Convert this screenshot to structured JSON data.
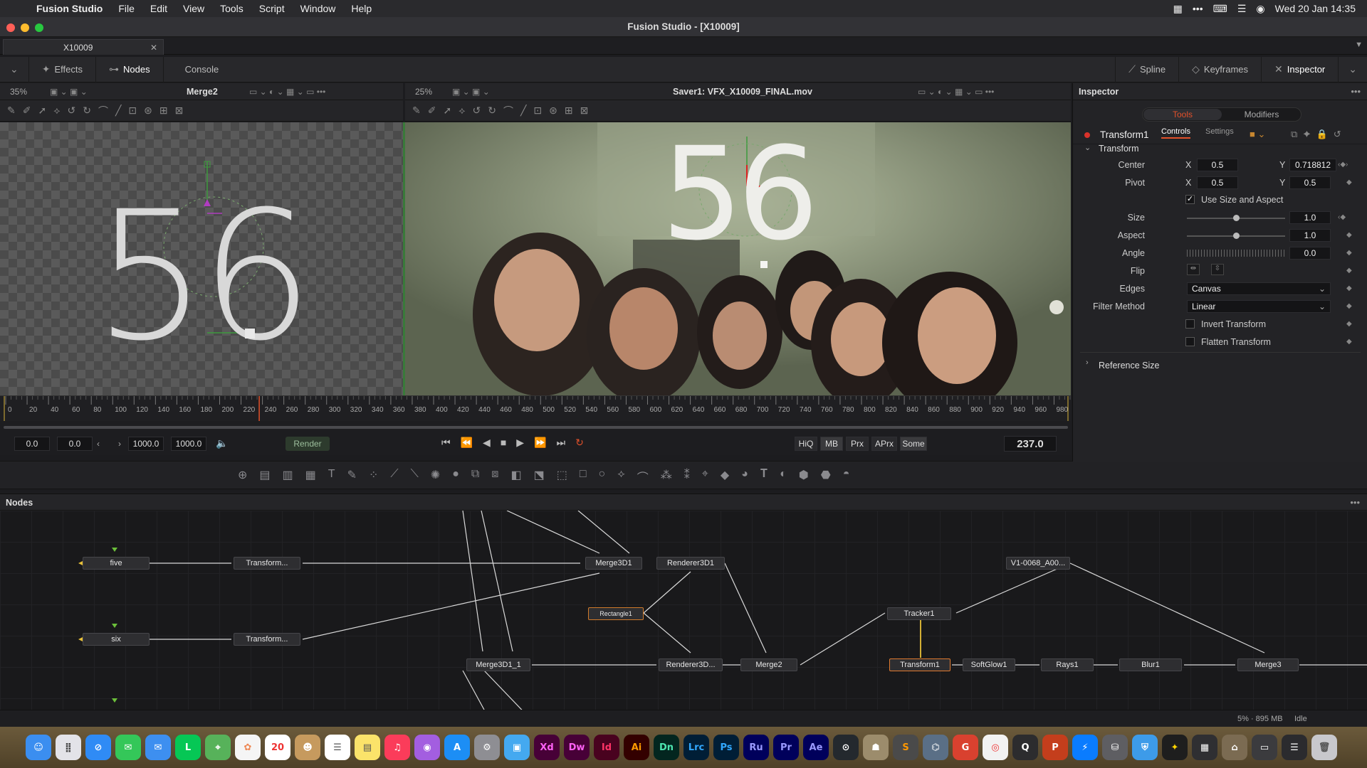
{
  "menubar": {
    "app": "Fusion Studio",
    "items": [
      "File",
      "Edit",
      "View",
      "Tools",
      "Script",
      "Window",
      "Help"
    ],
    "clock": "Wed 20 Jan  14:35"
  },
  "window": {
    "title": "Fusion Studio - [X10009]"
  },
  "doc_tab": {
    "label": "X10009"
  },
  "toolbar": {
    "effects": "Effects",
    "nodes": "Nodes",
    "console": "Console",
    "spline": "Spline",
    "keyframes": "Keyframes",
    "inspector": "Inspector"
  },
  "viewer_left": {
    "zoom": "35%",
    "name": "Merge2"
  },
  "viewer_right": {
    "zoom": "25%",
    "name": "Saver1: VFX_X10009_FINAL.mov"
  },
  "overlay_text": "56",
  "timeline": {
    "ticks": [
      "0",
      "20",
      "40",
      "60",
      "80",
      "100",
      "120",
      "140",
      "160",
      "180",
      "200",
      "220",
      "240",
      "260",
      "280",
      "300",
      "320",
      "340",
      "360",
      "380",
      "400",
      "420",
      "440",
      "460",
      "480",
      "500",
      "520",
      "540",
      "560",
      "580",
      "600",
      "620",
      "640",
      "660",
      "680",
      "700",
      "720",
      "740",
      "760",
      "780",
      "800",
      "820",
      "840",
      "860",
      "880",
      "900",
      "920",
      "940",
      "960",
      "980"
    ],
    "playhead_frame": 237
  },
  "transport": {
    "global_start": "0.0",
    "render_start": "0.0",
    "render_end": "1000.0",
    "global_end": "1000.0",
    "render": "Render",
    "hiq": "HiQ",
    "mb": "MB",
    "prx": "Prx",
    "aprx": "APrx",
    "some": "Some",
    "current_time": "237.0"
  },
  "inspector": {
    "title": "Inspector",
    "tab_tools": "Tools",
    "tab_modifiers": "Modifiers",
    "tool_name": "Transform1",
    "sub_controls": "Controls",
    "sub_settings": "Settings",
    "section": "Transform",
    "center_label": "Center",
    "center_x": "0.5",
    "center_y": "0.718812",
    "pivot_label": "Pivot",
    "pivot_x": "0.5",
    "pivot_y": "0.5",
    "x": "X",
    "y": "Y",
    "use_size": "Use Size and Aspect",
    "size_label": "Size",
    "size": "1.0",
    "aspect_label": "Aspect",
    "aspect": "1.0",
    "angle_label": "Angle",
    "angle": "0.0",
    "flip_label": "Flip",
    "edges_label": "Edges",
    "edges": "Canvas",
    "filter_label": "Filter Method",
    "filter": "Linear",
    "invert": "Invert Transform",
    "flatten": "Flatten Transform",
    "reference": "Reference Size",
    "size_level": 0.5,
    "aspect_level": 0.5,
    "use_size_checked": true
  },
  "nodes_panel": {
    "title": "Nodes"
  },
  "nodes": {
    "five": "five",
    "six": "six",
    "t1": "Transform...",
    "t2": "Transform...",
    "merge3d1": "Merge3D1",
    "renderer3d1": "Renderer3D1",
    "rect": "Rectangle1",
    "merge3d1_1": "Merge3D1_1",
    "renderer3d2": "Renderer3D...",
    "merge2": "Merge2",
    "v1": "V1-0068_A00...",
    "tracker1": "Tracker1",
    "transform1": "Transform1",
    "softglow1": "SoftGlow1",
    "rays1": "Rays1",
    "blur1": "Blur1",
    "merge3": "Merge3"
  },
  "status": {
    "mem": "5% · 895 MB",
    "state": "Idle"
  },
  "dock": [
    "Finder",
    "Launchpad",
    "Safari",
    "Messages",
    "Mail",
    "LINE",
    "Maps",
    "Photos",
    "Calendar",
    "Contacts",
    "Reminders",
    "Notes",
    "Music",
    "Podcasts",
    "App Store",
    "System Preferences",
    "Preview",
    "Xd",
    "Dw",
    "Id",
    "Ai",
    "Dn",
    "Lrc",
    "Ps",
    "Ru",
    "Pr",
    "Ae",
    "GitHub",
    "Automator",
    "Sublime",
    "Fusion",
    "Grammarly",
    "Chrome",
    "QuickTime",
    "PowerPoint",
    "Messenger",
    "Cleaner",
    "Shield",
    "Bolt",
    "Finder2",
    "Archive",
    "Migrate",
    "Stickies",
    "Trash"
  ],
  "colors": {
    "accent": "#e2512a",
    "node_border_sel": "#e07a2f",
    "flow": "#e8c038"
  }
}
